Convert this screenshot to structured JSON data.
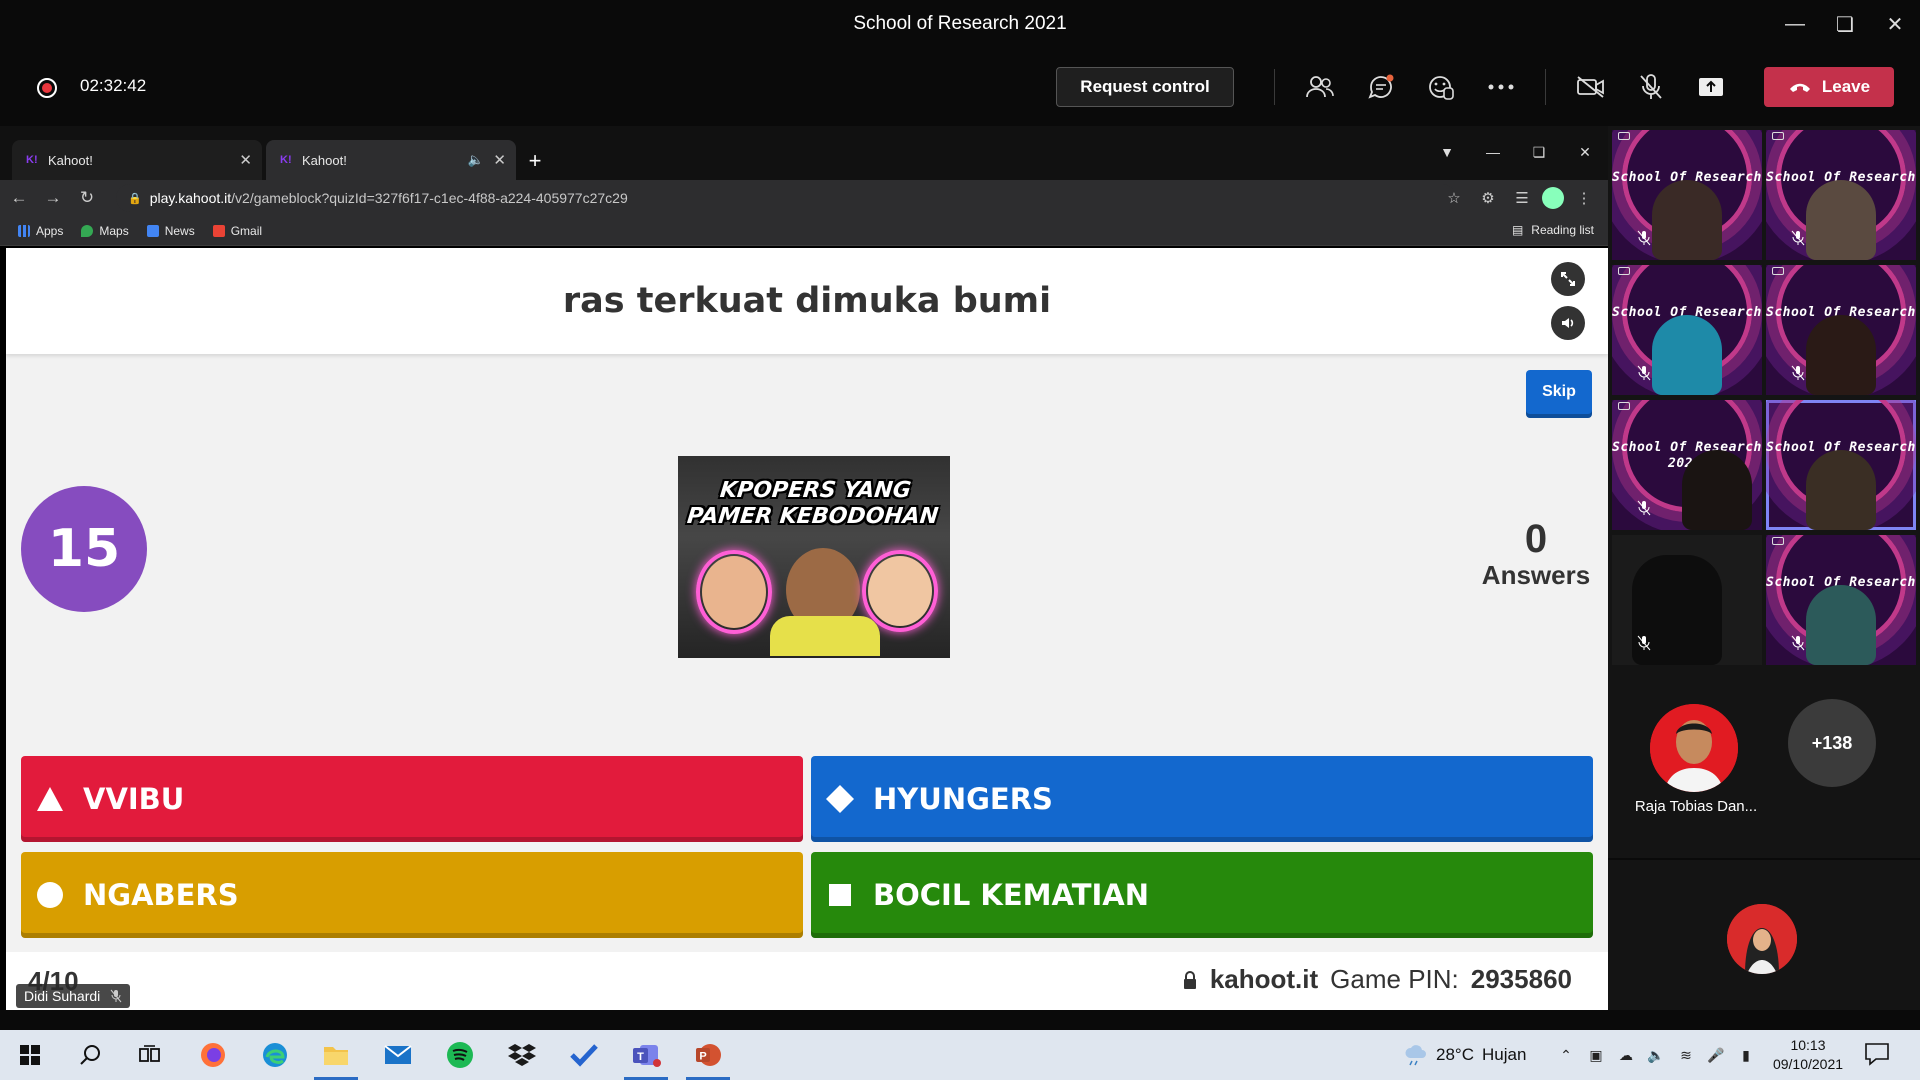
{
  "window": {
    "title": "School of Research 2021"
  },
  "meeting": {
    "elapsed": "02:32:42",
    "request_control_label": "Request control",
    "leave_label": "Leave"
  },
  "browser": {
    "tabs": [
      {
        "label": "Kahoot!"
      },
      {
        "label": "Kahoot!"
      }
    ],
    "url_host": "play.kahoot.it",
    "url_path": "/v2/gameblock?quizId=327f6f17-c1ec-4f88-a224-405977c27c29",
    "bookmarks": [
      {
        "label": "Apps"
      },
      {
        "label": "Maps"
      },
      {
        "label": "News"
      },
      {
        "label": "Gmail"
      }
    ],
    "reading_list_label": "Reading list"
  },
  "kahoot": {
    "question": "ras terkuat dimuka bumi",
    "skip_label": "Skip",
    "timer": "15",
    "answers_count": "0",
    "answers_label": "Answers",
    "image_caption_line1": "KPOPERS YANG",
    "image_caption_line2": "PAMER KEBODOHAN",
    "options": [
      {
        "label": "VVIBU",
        "color": "#e21b3c",
        "shape": "triangle"
      },
      {
        "label": "HYUNGERS",
        "color": "#1368ce",
        "shape": "diamond"
      },
      {
        "label": "NGABERS",
        "color": "#d89e00",
        "shape": "circle"
      },
      {
        "label": "BOCIL KEMATIAN",
        "color": "#26890c",
        "shape": "square"
      }
    ],
    "progress": "4/10",
    "site": "kahoot.it",
    "pin_label": "Game PIN:",
    "pin": "2935860"
  },
  "presenter": {
    "name": "Didi Suhardi"
  },
  "participants": {
    "tile_brand": "School Of Research",
    "tile_brand_sub": "2021",
    "featured_name": "Raja Tobias Dan...",
    "more_count": "+138"
  },
  "taskbar": {
    "temperature": "28°C",
    "weather": "Hujan",
    "time": "10:13",
    "date": "09/10/2021"
  }
}
